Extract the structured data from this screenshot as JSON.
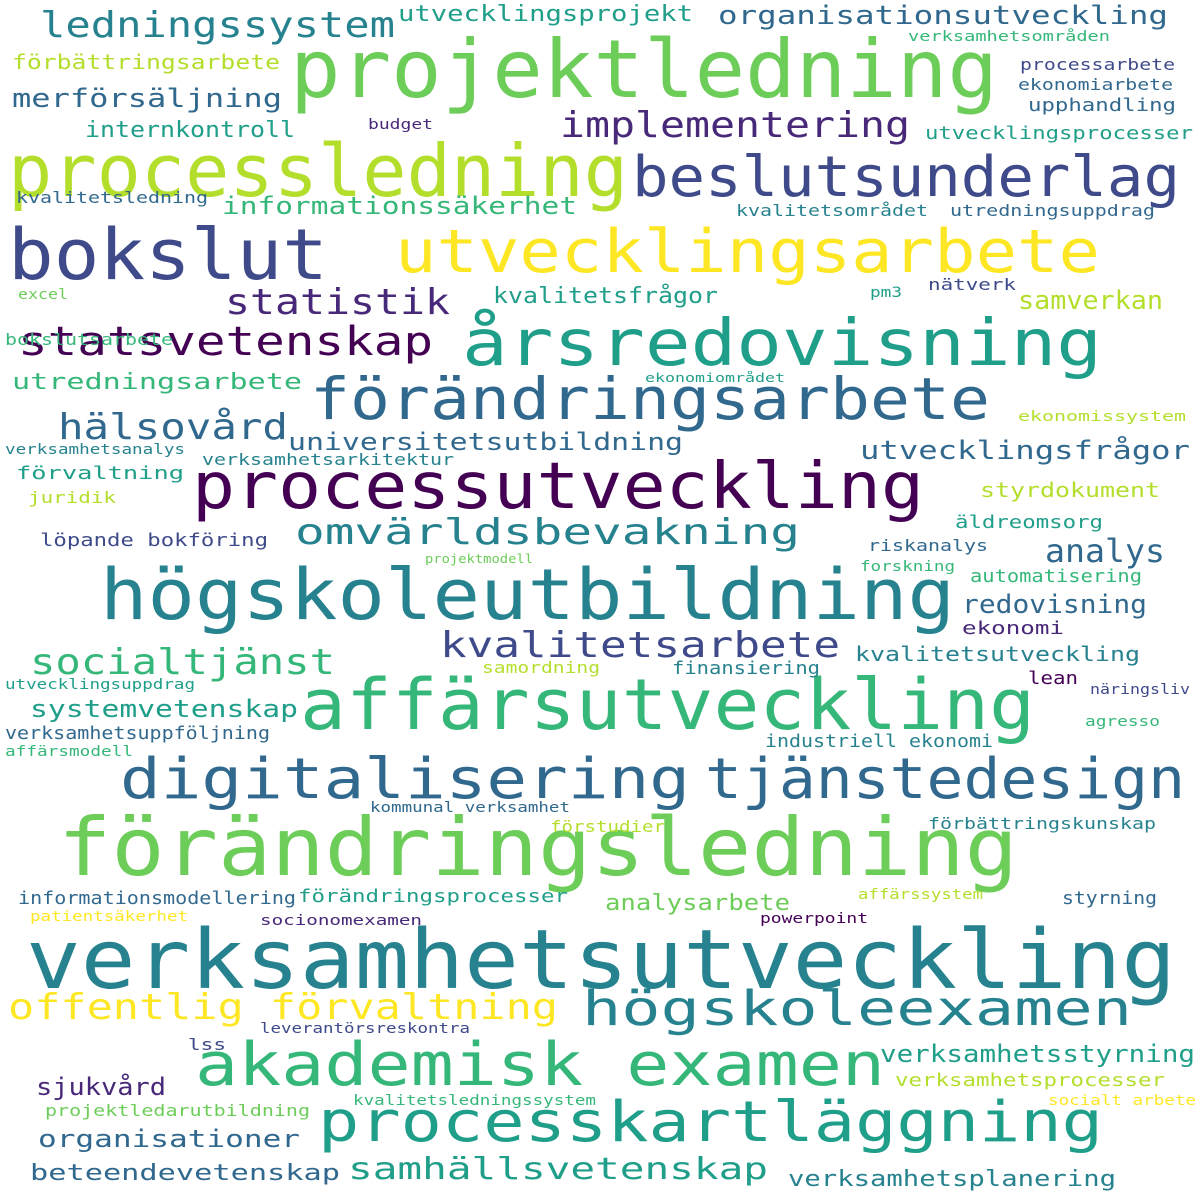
{
  "palette": {
    "dark_purple": "#440154",
    "indigo": "#482878",
    "slate_blue": "#3e4a89",
    "blue": "#31688e",
    "teal": "#26828e",
    "green_teal": "#1f9e89",
    "green": "#35b779",
    "light_green": "#6dcd59",
    "lime": "#b4de2c",
    "yellow": "#fde725"
  },
  "words": [
    {
      "text": "verksamhetsutveckling"
    },
    {
      "text": "förändringsledning"
    },
    {
      "text": "projektledning"
    },
    {
      "text": "processledning"
    },
    {
      "text": "högskoleutbildning"
    },
    {
      "text": "affärsutveckling"
    },
    {
      "text": "bokslut"
    },
    {
      "text": "processutveckling"
    },
    {
      "text": "årsredovisning"
    },
    {
      "text": "utvecklingsarbete"
    },
    {
      "text": "beslutsunderlag"
    },
    {
      "text": "processkartläggning"
    },
    {
      "text": "akademisk examen"
    },
    {
      "text": "förändringsarbete"
    },
    {
      "text": "digitalisering"
    },
    {
      "text": "tjänstedesign"
    },
    {
      "text": "högskoleexamen"
    },
    {
      "text": "ledningssystem"
    },
    {
      "text": "implementering"
    },
    {
      "text": "offentlig förvaltning"
    },
    {
      "text": "statsvetenskap"
    },
    {
      "text": "omvärldsbevakning"
    },
    {
      "text": "kvalitetsarbete"
    },
    {
      "text": "statistik"
    },
    {
      "text": "socialtjänst"
    },
    {
      "text": "hälsovård"
    },
    {
      "text": "samhällsvetenskap"
    },
    {
      "text": "organisationsutveckling"
    },
    {
      "text": "analys"
    },
    {
      "text": "utvecklingsfrågor"
    },
    {
      "text": "universitetsutbildning"
    },
    {
      "text": "samverkan"
    },
    {
      "text": "merförsäljning"
    },
    {
      "text": "informationssäkerhet"
    },
    {
      "text": "utvecklingsprojekt"
    },
    {
      "text": "verksamhetsstyrning"
    },
    {
      "text": "redovisning"
    },
    {
      "text": "systemvetenskap"
    },
    {
      "text": "organisationer"
    },
    {
      "text": "kvalitetsfrågor"
    },
    {
      "text": "analysarbete"
    },
    {
      "text": "utredningsarbete"
    },
    {
      "text": "förbättringsarbete"
    },
    {
      "text": "internkontroll"
    },
    {
      "text": "beteendevetenskap"
    },
    {
      "text": "verksamhetsplanering"
    },
    {
      "text": "kvalitetsutveckling"
    },
    {
      "text": "styrdokument"
    },
    {
      "text": "sjukvård"
    },
    {
      "text": "verksamhetsprocesser"
    },
    {
      "text": "förändringsprocesser"
    },
    {
      "text": "informationsmodellering"
    },
    {
      "text": "verksamhetsuppföljning"
    },
    {
      "text": "löpande bokföring"
    },
    {
      "text": "äldreomsorg"
    },
    {
      "text": "automatisering"
    },
    {
      "text": "ekonomi"
    },
    {
      "text": "finansiering"
    },
    {
      "text": "industriell ekonomi"
    },
    {
      "text": "förvaltning"
    },
    {
      "text": "verksamhetsarkitektur"
    },
    {
      "text": "kvalitetsledning"
    },
    {
      "text": "kvalitetsområdet"
    },
    {
      "text": "utredningsuppdrag"
    },
    {
      "text": "utvecklingsprocesser"
    },
    {
      "text": "upphandling"
    },
    {
      "text": "ekonomiarbete"
    },
    {
      "text": "processarbete"
    },
    {
      "text": "verksamhetsområden"
    },
    {
      "text": "bokslutsarbete"
    },
    {
      "text": "ekonomissystem"
    },
    {
      "text": "riskanalys"
    },
    {
      "text": "styrning"
    },
    {
      "text": "förstudier"
    },
    {
      "text": "förbättringskunskap"
    },
    {
      "text": "projektledarutbildning"
    },
    {
      "text": "samordning"
    },
    {
      "text": "juridik"
    },
    {
      "text": "nätverk"
    },
    {
      "text": "lean"
    },
    {
      "text": "budget"
    },
    {
      "text": "verksamhetsanalys"
    },
    {
      "text": "utvecklingsuppdrag"
    },
    {
      "text": "affärsmodell"
    },
    {
      "text": "kommunal verksamhet"
    },
    {
      "text": "socionomexamen"
    },
    {
      "text": "powerpoint"
    },
    {
      "text": "leverantörsreskontra"
    },
    {
      "text": "lss"
    },
    {
      "text": "kvalitetsledningssystem"
    },
    {
      "text": "socialt arbete"
    },
    {
      "text": "patientsäkerhet"
    },
    {
      "text": "affärssystem"
    },
    {
      "text": "näringsliv"
    },
    {
      "text": "agresso"
    },
    {
      "text": "forskning"
    },
    {
      "text": "projektmodell"
    },
    {
      "text": "ekonomiområdet"
    },
    {
      "text": "pm3"
    },
    {
      "text": "excel"
    }
  ]
}
